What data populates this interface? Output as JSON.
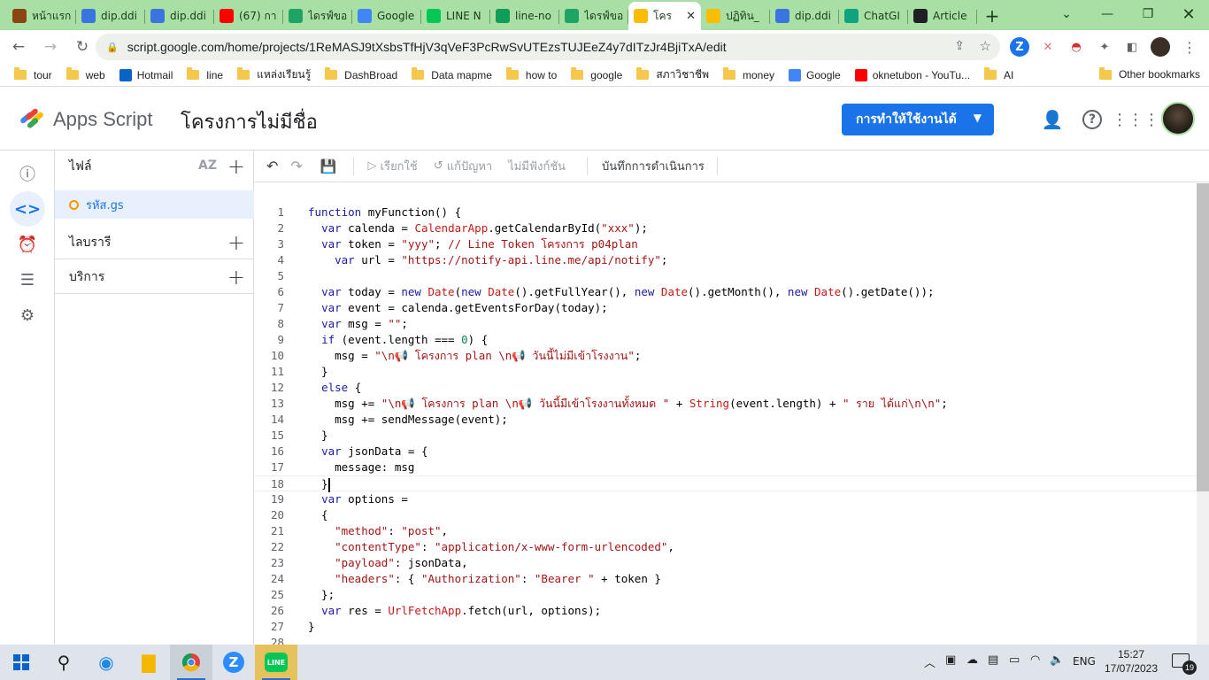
{
  "browser": {
    "tabs": [
      {
        "title": "หน้าแรก",
        "icon": "avatar-icon",
        "color": "#8b4513"
      },
      {
        "title": "dip.ddi",
        "icon": "drop-icon",
        "color": "#3b73e0"
      },
      {
        "title": "dip.ddi",
        "icon": "drop-icon",
        "color": "#3b73e0"
      },
      {
        "title": "(67) กา",
        "icon": "youtube-icon",
        "color": "#ff0000"
      },
      {
        "title": "ไดรฟ์ของ",
        "icon": "drive-icon",
        "color": "#1fa463"
      },
      {
        "title": "Google",
        "icon": "calendar-icon",
        "color": "#4285f4"
      },
      {
        "title": "LINE N",
        "icon": "line-icon",
        "color": "#06c755"
      },
      {
        "title": "line-no",
        "icon": "sheets-icon",
        "color": "#0f9d58"
      },
      {
        "title": "ไดรฟ์ของ",
        "icon": "drive-icon",
        "color": "#1fa463"
      },
      {
        "title": "โคร",
        "icon": "apps-script-icon",
        "color": "#fbbc04",
        "active": true
      },
      {
        "title": "ปฏิทิน_",
        "icon": "apps-script-icon",
        "color": "#fbbc04"
      },
      {
        "title": "dip.ddi",
        "icon": "drop-icon",
        "color": "#3b73e0"
      },
      {
        "title": "ChatGI",
        "icon": "openai-icon",
        "color": "#10a37f"
      },
      {
        "title": "Article",
        "icon": "joomla-icon",
        "color": "#202124"
      }
    ],
    "url": "script.google.com/home/projects/1ReMASJ9tXsbsTfHjV3qVeF3PcRwSvUTEzsTUJEeZ4y7dITzJr4BjiTxA/edit",
    "bookmarks": [
      "tour",
      "web",
      "Hotmail",
      "line",
      "แหล่งเรียนรู้",
      "DashBroad",
      "Data mapme",
      "how to",
      "google",
      "สภาวิชาชีพ",
      "money",
      "Google",
      "oknetubon - YouTu...",
      "AI"
    ],
    "other_bookmarks": "Other bookmarks"
  },
  "app": {
    "name": "Apps Script",
    "project": "โครงการไม่มีชื่อ",
    "deploy_label": "การทำให้ใช้งานได้"
  },
  "files_panel": {
    "files_title": "ไฟล์",
    "sort_label": "AZ",
    "active_file": "รหัส.gs",
    "libraries_title": "ไลบรารี",
    "services_title": "บริการ"
  },
  "editor_toolbar": {
    "run": "เรียกใช้",
    "debug": "แก้ปัญหา",
    "no_function": "ไม่มีฟังก์ชัน",
    "exec_log": "บันทึกการดำเนินการ"
  },
  "code_lines": [
    "function myFunction() {",
    "  var calenda = CalendarApp.getCalendarById(\"xxx\");",
    "  var token = \"yyy\"; // Line Token โครงการ p04plan",
    "    var url = \"https://notify-api.line.me/api/notify\";",
    "",
    "  var today = new Date(new Date().getFullYear(), new Date().getMonth(), new Date().getDate());",
    "  var event = calenda.getEventsForDay(today);",
    "  var msg = \"\";",
    "  if (event.length === 0) {",
    "    msg = \"\\n📢 โครงการ plan \\n📢 วันนี้ไม่มีเข้าโรงงาน\";",
    "  }",
    "  else {",
    "    msg += \"\\n📢 โครงการ plan \\n📢 วันนี้มีเข้าโรงงานทั้งหมด \" + String(event.length) + \" ราย ได้แก่\\n\\n\";",
    "    msg += sendMessage(event);",
    "  }",
    "  var jsonData = {",
    "    message: msg",
    "  }",
    "  var options =",
    "  {",
    "    \"method\": \"post\",",
    "    \"contentType\": \"application/x-www-form-urlencoded\",",
    "    \"payload\": jsonData,",
    "    \"headers\": { \"Authorization\": \"Bearer \" + token }",
    "  };",
    "  var res = UrlFetchApp.fetch(url, options);",
    "}",
    ""
  ],
  "cursor_line": 18,
  "taskbar": {
    "lang": "ENG",
    "time": "15:27",
    "date": "17/07/2023",
    "notifications": "19"
  },
  "colors": {
    "tab_strip": "#a8dfa5",
    "accent": "#1a73e8",
    "file_dot": "#f29900"
  }
}
